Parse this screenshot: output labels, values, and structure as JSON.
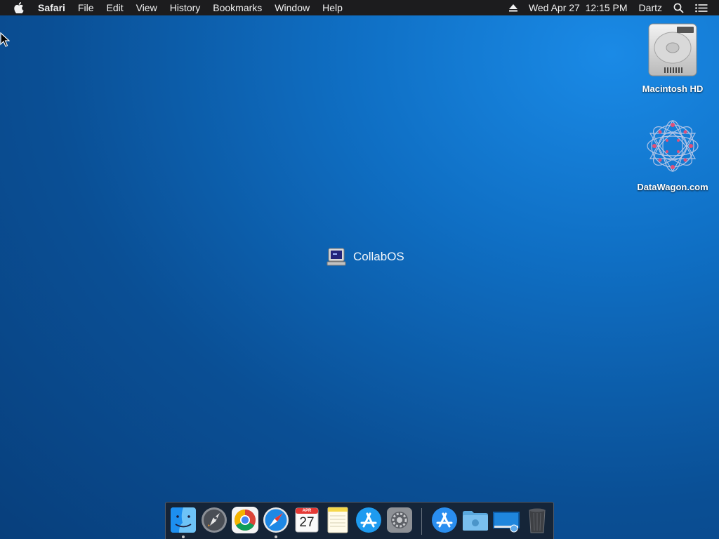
{
  "menubar": {
    "apple_icon": "apple-logo-icon",
    "app_name": "Safari",
    "items": [
      "File",
      "Edit",
      "View",
      "History",
      "Bookmarks",
      "Window",
      "Help"
    ],
    "eject_icon": "eject-icon",
    "datetime": "Wed Apr 27  12:15 PM",
    "user": "Dartz",
    "search_icon": "spotlight-search-icon",
    "list_icon": "notification-center-icon"
  },
  "desktop": {
    "icons": [
      {
        "label": "Macintosh HD",
        "icon": "hard-drive-icon"
      },
      {
        "label": "DataWagon.com",
        "icon": "datawagon-network-icon"
      }
    ],
    "center_label": "CollabOS",
    "center_icon": "computer-terminal-icon"
  },
  "dock": {
    "apps": [
      {
        "name": "finder",
        "running": true
      },
      {
        "name": "launchpad",
        "running": false
      },
      {
        "name": "chrome",
        "running": false
      },
      {
        "name": "safari",
        "running": true
      },
      {
        "name": "calendar",
        "running": false,
        "month": "APR",
        "day": "27"
      },
      {
        "name": "notes",
        "running": false
      },
      {
        "name": "app-store",
        "running": false
      },
      {
        "name": "system-preferences",
        "running": false
      },
      {
        "name": "app-store-downloads",
        "running": false
      },
      {
        "name": "downloads-folder",
        "running": false
      },
      {
        "name": "screen-sharing",
        "running": false
      },
      {
        "name": "trash",
        "running": false
      }
    ]
  },
  "colors": {
    "menubar_bg": "#1c1c1e",
    "desktop_blue": "#0f6fc4"
  }
}
